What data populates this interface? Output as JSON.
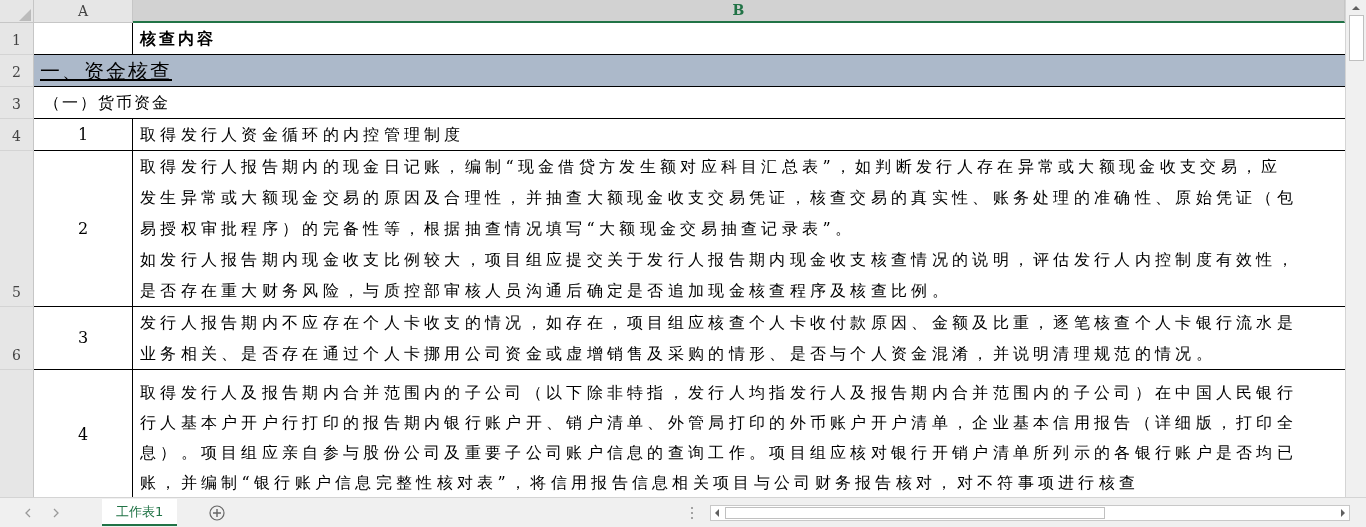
{
  "columns": [
    {
      "label": "A",
      "selected": false
    },
    {
      "label": "B",
      "selected": true
    }
  ],
  "rows": [
    {
      "number": "1",
      "kind": "header",
      "text": "核查内容"
    },
    {
      "number": "2",
      "kind": "section",
      "text": "一、资金核查"
    },
    {
      "number": "3",
      "kind": "subsection",
      "text": "（一）货币资金"
    },
    {
      "number": "4",
      "kind": "item",
      "index": "1",
      "lines": [
        "取得发行人资金循环的内控管理制度"
      ]
    },
    {
      "number": "5",
      "kind": "item",
      "index": "2",
      "lines": [
        "取得发行人报告期内的现金日记账，编制“现金借贷方发生额对应科目汇总表”，如判断发行人存在异常或大额现金收支交易，应",
        "发生异常或大额现金交易的原因及合理性，并抽查大额现金收支交易凭证，核查交易的真实性、账务处理的准确性、原始凭证（包",
        "易授权审批程序）的完备性等，根据抽查情况填写“大额现金交易抽查记录表”。",
        "如发行人报告期内现金收支比例较大，项目组应提交关于发行人报告期内现金收支核查情况的说明，评估发行人内控制度有效性，",
        "是否存在重大财务风险，与质控部审核人员沟通后确定是否追加现金核查程序及核查比例。"
      ]
    },
    {
      "number": "6",
      "kind": "item",
      "index": "3",
      "lines": [
        "发行人报告期内不应存在个人卡收支的情况，如存在，项目组应核查个人卡收付款原因、金额及比重，逐笔核查个人卡银行流水是",
        "业务相关、是否存在通过个人卡挪用公司资金或虚增销售及采购的情形、是否与个人资金混淆，并说明清理规范的情况。"
      ]
    },
    {
      "kind": "item",
      "index": "4",
      "lines": [
        "取得发行人及报告期内合并范围内的子公司（以下除非特指，发行人均指发行人及报告期内合并范围内的子公司）在中国人民银行",
        "行人基本户开户行打印的报告期内银行账户开、销户清单、外管局打印的外币账户开户清单，企业基本信用报告（详细版，打印全",
        "息）。项目组应亲自参与股份公司及重要子公司账户信息的查询工作。项目组应核对银行开销户清单所列示的各银行账户是否均已",
        "账，并编制“银行账户信息完整性核对表”，将信用报告信息相关项目与公司财务报告核对，对不符事项进行核查"
      ]
    }
  ],
  "sheet_tabs": [
    {
      "label": "工作表1",
      "selected": true
    }
  ]
}
